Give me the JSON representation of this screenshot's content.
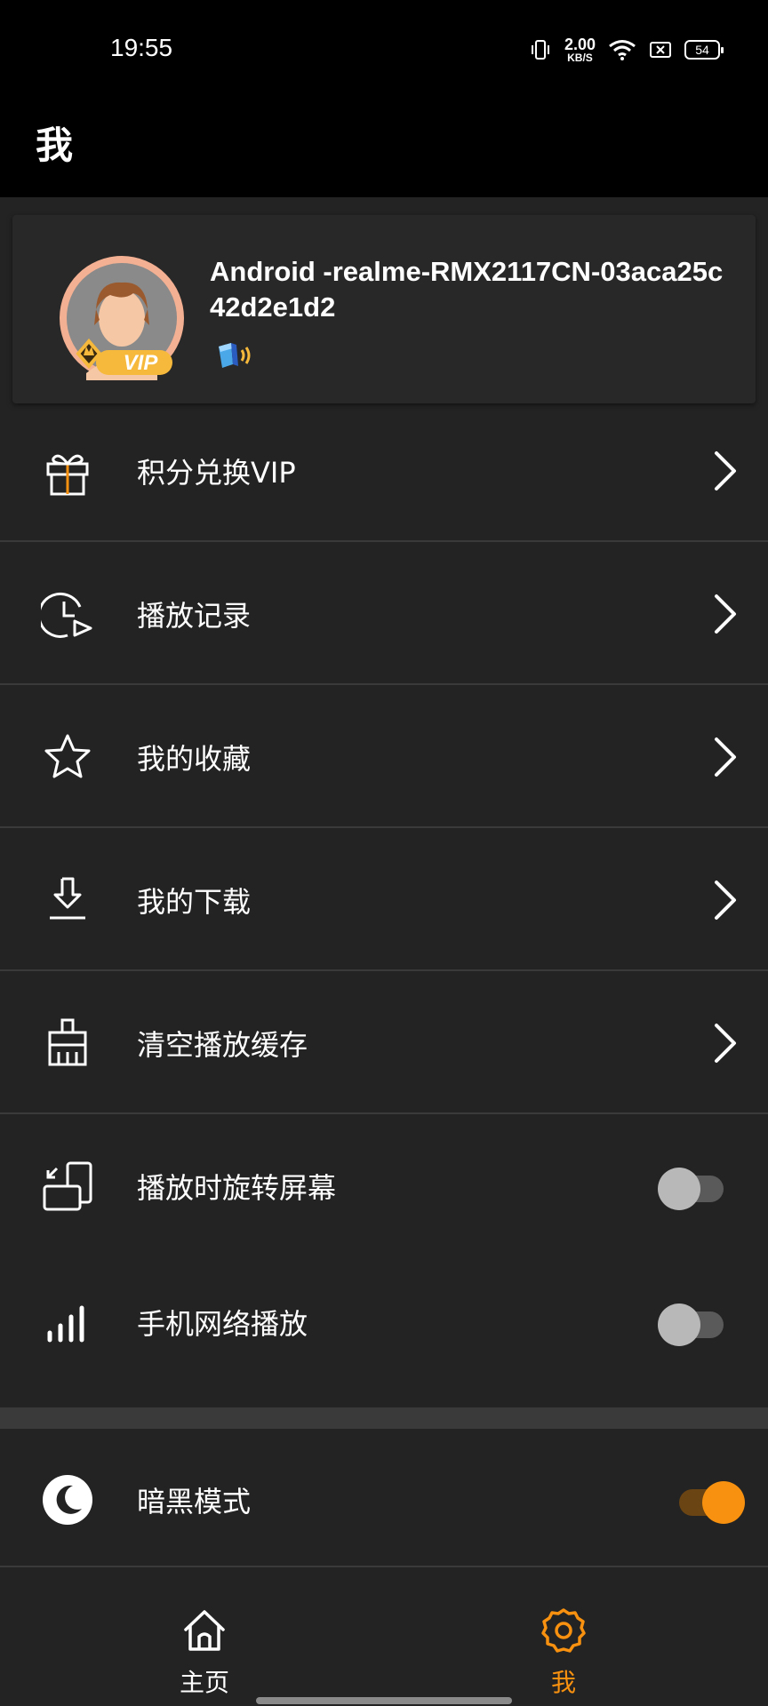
{
  "status_bar": {
    "time": "19:55",
    "net_speed_value": "2.00",
    "net_speed_unit": "KB/S",
    "battery": "54",
    "icons": [
      "vibrate-icon",
      "wifi-icon",
      "sim-icon",
      "battery-icon"
    ]
  },
  "header": {
    "title": "我"
  },
  "profile": {
    "name": "Android -realme-RMX2117CN-03aca25c42d2e1d2",
    "vip_label": "VIP"
  },
  "menu": [
    {
      "label": "积分兑换VIP",
      "icon": "gift-icon"
    },
    {
      "label": "播放记录",
      "icon": "history-icon"
    },
    {
      "label": "我的收藏",
      "icon": "star-icon"
    },
    {
      "label": "我的下载",
      "icon": "download-icon"
    },
    {
      "label": "清空播放缓存",
      "icon": "broom-icon"
    }
  ],
  "toggles": [
    {
      "label": "播放时旋转屏幕",
      "icon": "rotate-screen-icon",
      "on": false
    },
    {
      "label": "手机网络播放",
      "icon": "signal-icon",
      "on": false
    },
    {
      "label": "暗黑模式",
      "icon": "moon-icon",
      "on": true
    }
  ],
  "bottom_nav": {
    "home_label": "主页",
    "me_label": "我"
  },
  "colors": {
    "accent": "#f7910f",
    "background": "#232323",
    "card": "#282828"
  }
}
